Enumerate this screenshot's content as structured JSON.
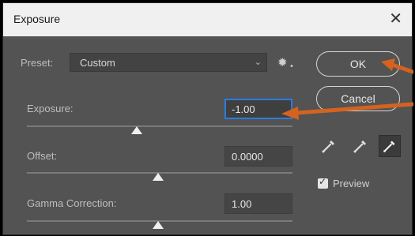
{
  "window": {
    "title": "Exposure",
    "close_glyph": "✕"
  },
  "preset": {
    "label": "Preset:",
    "value": "Custom",
    "chevron": "⌄"
  },
  "settings_icon": "gear-icon",
  "buttons": {
    "ok": "OK",
    "cancel": "Cancel"
  },
  "fields": {
    "exposure": {
      "label": "Exposure:",
      "value": "-1.00",
      "slider_level": 0.42
    },
    "offset": {
      "label": "Offset:",
      "value": "0.0000",
      "slider_level": 0.5
    },
    "gamma": {
      "label": "Gamma Correction:",
      "value": "1.00",
      "slider_level": 0.5
    }
  },
  "preview": {
    "label": "Preview",
    "checked": true
  },
  "eyedroppers": [
    "black-point-eyedropper-icon",
    "gray-point-eyedropper-icon",
    "white-point-eyedropper-icon"
  ],
  "colors": {
    "annotation_arrow": "#d4631f",
    "focus_border": "#2d7be0",
    "dialog_bg": "#535353"
  }
}
